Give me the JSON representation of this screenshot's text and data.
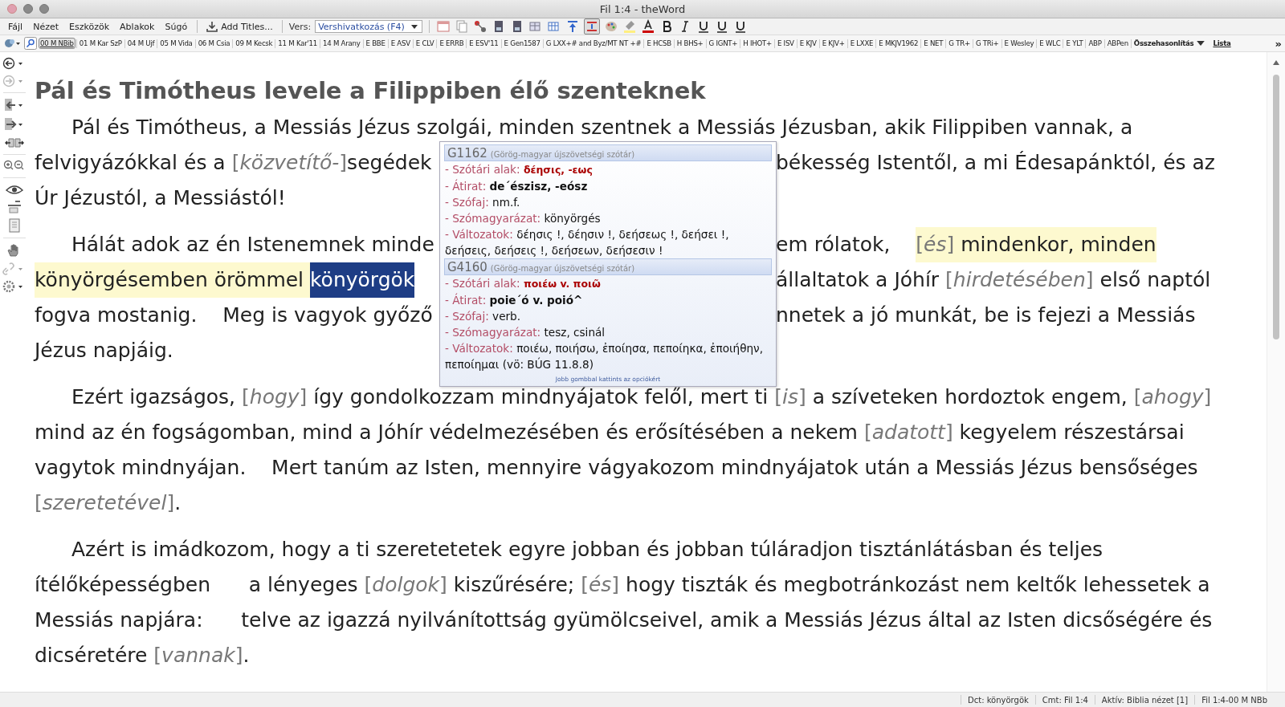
{
  "window": {
    "title": "Fil 1:4 - theWord"
  },
  "menu": [
    "Fájl",
    "Nézet",
    "Eszközök",
    "Ablakok",
    "Súgó"
  ],
  "toolbar": {
    "add_titles": "Add Titles...",
    "verse_label": "Vers:",
    "verse_select": "Vershivatkozás (F4)"
  },
  "modules": [
    {
      "kind": "module",
      "label": "00 M NBib",
      "selected": true
    },
    {
      "kind": "module",
      "label": "01 M Kar SzP",
      "selected": false
    },
    {
      "kind": "module",
      "label": "04 M Ujf",
      "selected": false
    },
    {
      "kind": "module",
      "label": "05 M Vida",
      "selected": false
    },
    {
      "kind": "module",
      "label": "06 M Csia",
      "selected": false
    },
    {
      "kind": "module",
      "label": "09 M Kecsk",
      "selected": false
    },
    {
      "kind": "module",
      "label": "11 M Kar'11",
      "selected": false
    },
    {
      "kind": "module",
      "label": "14 M Arany",
      "selected": false
    },
    {
      "kind": "module",
      "label": "E BBE",
      "selected": false
    },
    {
      "kind": "module",
      "label": "E ASV",
      "selected": false
    },
    {
      "kind": "module",
      "label": "E CLV",
      "selected": false
    },
    {
      "kind": "module",
      "label": "E ERRB",
      "selected": false
    },
    {
      "kind": "module",
      "label": "E ESV'11",
      "selected": false
    },
    {
      "kind": "module",
      "label": "E Gen1587",
      "selected": false
    },
    {
      "kind": "module",
      "label": "G LXX+# and Byz/MT NT +#",
      "selected": false
    },
    {
      "kind": "module",
      "label": "E HCSB",
      "selected": false
    },
    {
      "kind": "module",
      "label": "H BHS+",
      "selected": false
    },
    {
      "kind": "module",
      "label": "G IGNT+",
      "selected": false
    },
    {
      "kind": "module",
      "label": "H IHOT+",
      "selected": false
    },
    {
      "kind": "module",
      "label": "E ISV",
      "selected": false
    },
    {
      "kind": "module",
      "label": "E KJV",
      "selected": false
    },
    {
      "kind": "module",
      "label": "E KJV+",
      "selected": false
    },
    {
      "kind": "module",
      "label": "E LXXE",
      "selected": false
    },
    {
      "kind": "module",
      "label": "E MKJV1962",
      "selected": false
    },
    {
      "kind": "module",
      "label": "E NET",
      "selected": false
    },
    {
      "kind": "module",
      "label": "G TR+",
      "selected": false
    },
    {
      "kind": "module",
      "label": "G TRi+",
      "selected": false
    },
    {
      "kind": "module",
      "label": "E Wesley",
      "selected": false
    },
    {
      "kind": "module",
      "label": "E WLC",
      "selected": false
    },
    {
      "kind": "module",
      "label": "E YLT",
      "selected": false
    },
    {
      "kind": "module",
      "label": "ABP",
      "selected": false
    },
    {
      "kind": "module",
      "label": "ABPen",
      "selected": false
    },
    {
      "kind": "menu",
      "label": "Összehasonlítás",
      "selected": false
    },
    {
      "kind": "link",
      "label": "Lista",
      "selected": false
    }
  ],
  "overflow_mark": "»",
  "heading": "Pál és Timótheus levele a Filippiben élő szenteknek",
  "paragraphs": [
    {
      "lines": [
        {
          "segments": [
            {
              "kind": "text",
              "text": "Pál és Timótheus, a Messiás Jézus szolgái, minden szentnek a Messiás Jézusban, akik Filippiben vannak, a"
            }
          ]
        },
        {
          "left": [
            {
              "kind": "text",
              "text": "felvigyázókkal és a "
            },
            {
              "kind": "note",
              "text": "[*közvetítő-*]"
            },
            {
              "kind": "text",
              "text": "segédek"
            }
          ],
          "right": [
            {
              "kind": "text",
              "text": "békesség Istentől, a mi Édesapánktól, és az"
            }
          ]
        },
        {
          "segments": [
            {
              "kind": "text",
              "text": "Úr Jézustól, a Messiástól!"
            }
          ]
        }
      ]
    },
    {
      "lines": [
        {
          "left": [
            {
              "kind": "text",
              "text": "Hálát adok az én Istenemnek minde"
            }
          ],
          "right": [
            {
              "kind": "text",
              "text": "em rólatok,    "
            },
            {
              "kind": "highlight-note",
              "text": "[*és*]"
            },
            {
              "kind": "highlight",
              "text": " mindenkor, minden"
            }
          ]
        },
        {
          "left": [
            {
              "kind": "highlight",
              "text": "könyörgésemben örömmel "
            },
            {
              "kind": "selected",
              "text": "könyörgök"
            }
          ],
          "right": [
            {
              "kind": "text",
              "text": "állaltatok a Jóhír "
            },
            {
              "kind": "note",
              "text": "[*hirdetésében*]"
            },
            {
              "kind": "text",
              "text": " első naptól"
            }
          ]
        },
        {
          "left": [
            {
              "kind": "text",
              "text": "fogva mostanig.    Meg is vagyok győző"
            }
          ],
          "right": [
            {
              "kind": "text",
              "text": "nnetek a jó munkát, be is fejezi a Messiás"
            }
          ]
        },
        {
          "segments": [
            {
              "kind": "text",
              "text": "Jézus napjáig."
            }
          ]
        }
      ]
    },
    {
      "lines": [
        {
          "segments": [
            {
              "kind": "text",
              "text": "Ezért igazságos, "
            },
            {
              "kind": "note",
              "text": "[*hogy*]"
            },
            {
              "kind": "text",
              "text": " így gondolkozzam mindnyájatok felől, mert ti "
            },
            {
              "kind": "note",
              "text": "[*is*]"
            },
            {
              "kind": "text",
              "text": " a szíveteken hordoztok engem, "
            },
            {
              "kind": "note",
              "text": "[*ahogy*]"
            }
          ]
        },
        {
          "segments": [
            {
              "kind": "text",
              "text": "mind az én fogságomban, mind a Jóhír védelmezésében és erősítésében a nekem "
            },
            {
              "kind": "note",
              "text": "[*adatott*]"
            },
            {
              "kind": "text",
              "text": " kegyelem részestársai"
            }
          ]
        },
        {
          "segments": [
            {
              "kind": "text",
              "text": "vagytok mindnyájan.    Mert tanúm az Isten, mennyire vágyakozom mindnyájatok után a Messiás Jézus bensőséges"
            }
          ]
        },
        {
          "segments": [
            {
              "kind": "note",
              "text": "[*szeretetével*]"
            },
            {
              "kind": "text",
              "text": "."
            }
          ]
        }
      ]
    },
    {
      "lines": [
        {
          "segments": [
            {
              "kind": "text",
              "text": "Azért is imádkozom, hogy a ti szeretetetek egyre jobban és jobban túláradjon tisztánlátásban és teljes"
            }
          ]
        },
        {
          "segments": [
            {
              "kind": "text",
              "text": "ítélőképességben      a lényeges "
            },
            {
              "kind": "note",
              "text": "[*dolgok*]"
            },
            {
              "kind": "text",
              "text": " kiszűrésére; "
            },
            {
              "kind": "note",
              "text": "[*és*]"
            },
            {
              "kind": "text",
              "text": " hogy tiszták és megbotránkozást nem keltők lehessetek a"
            }
          ]
        },
        {
          "segments": [
            {
              "kind": "text",
              "text": "Messiás napjára:      telve az igazzá nyilvánítottság gyümölcseivel, amik a Messiás Jézus által az Isten dicsőségére és"
            }
          ]
        },
        {
          "segments": [
            {
              "kind": "text",
              "text": "dicséretére "
            },
            {
              "kind": "note",
              "text": "[*vannak*]"
            },
            {
              "kind": "text",
              "text": "."
            }
          ]
        }
      ]
    }
  ],
  "popup": {
    "entries": [
      {
        "code": "G1162",
        "source": "(Görög-magyar újszövetségi szótár)",
        "fields": [
          {
            "kind": "greek",
            "label": "- Szótári alak:",
            "value": "δέησις, -εως"
          },
          {
            "kind": "translit",
            "label": "- Átirat:",
            "value": "de´észisz, -eósz"
          },
          {
            "kind": "plain",
            "label": "- Szófaj:",
            "value": "nm.f."
          },
          {
            "kind": "plain",
            "label": "- Szómagyarázat:",
            "value": "könyörgés"
          },
          {
            "kind": "plain",
            "label": "- Változatok:",
            "value": "δέησις !, δέησιν !, δεήσεως !, δεήσει !, δεήσεις, δεήσεις !, δεήσεων, δεήσεσιν !"
          }
        ]
      },
      {
        "code": "G4160",
        "source": "(Görög-magyar újszövetségi szótár)",
        "fields": [
          {
            "kind": "greek",
            "label": "- Szótári alak:",
            "value": "ποιέω v. ποιῶ"
          },
          {
            "kind": "translit",
            "label": "- Átirat:",
            "value": "poie´ó v. poió^"
          },
          {
            "kind": "plain",
            "label": "- Szófaj:",
            "value": "verb."
          },
          {
            "kind": "plain",
            "label": "- Szómagyarázat:",
            "value": "tesz, csinál"
          },
          {
            "kind": "plain",
            "label": "- Változatok:",
            "value": "ποιέω, ποιήσω, ἐποίησα, πεποίηκα, ἐποιήθην, πεποίημαι (vö: BÚG 11.8.8)"
          }
        ]
      }
    ],
    "footer": "Jobb gombbal kattints az opciókért"
  },
  "status_bar": [
    "Dct: könyörgök",
    "Cmt: Fil 1:4",
    "Aktív: Biblia nézet [1]",
    "Fil 1:4-00 M NBb"
  ]
}
